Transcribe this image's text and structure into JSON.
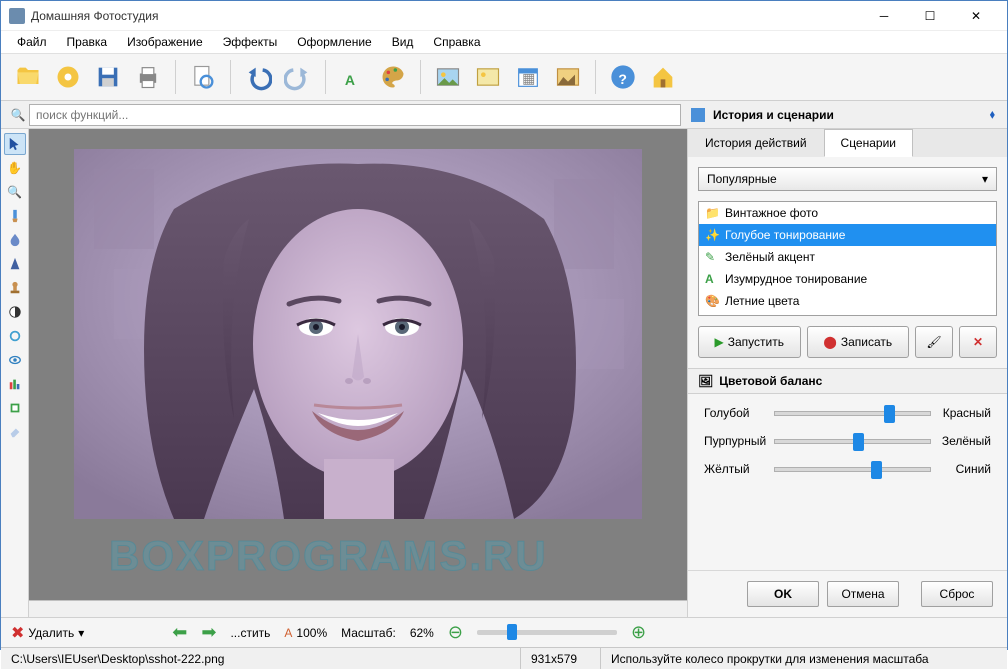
{
  "window": {
    "title": "Домашняя Фотостудия"
  },
  "menu": [
    "Файл",
    "Правка",
    "Изображение",
    "Эффекты",
    "Оформление",
    "Вид",
    "Справка"
  ],
  "toolbar_icons": [
    "open-folder-icon",
    "cd-icon",
    "save-icon",
    "print-icon",
    "preview-icon",
    "undo-icon",
    "redo-icon",
    "text-icon",
    "palette-icon",
    "image-1-icon",
    "image-2-icon",
    "calendar-icon",
    "templates-icon",
    "help-icon",
    "home-icon"
  ],
  "search": {
    "placeholder": "поиск функций..."
  },
  "left_tools": [
    "pointer-icon",
    "hand-icon",
    "zoom-icon",
    "brush-icon",
    "blur-drop-icon",
    "sharpen-icon",
    "stamp-icon",
    "contrast-icon",
    "circle-icon",
    "eye-icon",
    "levels-icon",
    "crop-icon",
    "eraser-icon"
  ],
  "right_panel": {
    "header": "История и сценарии",
    "tabs": [
      "История действий",
      "Сценарии"
    ],
    "active_tab": 1,
    "dropdown": "Популярные",
    "scenarios": [
      {
        "label": "Винтажное фото",
        "icon": "folder",
        "selected": false
      },
      {
        "label": "Голубое тонирование",
        "icon": "wand",
        "selected": true
      },
      {
        "label": "Зелёный акцент",
        "icon": "pencil",
        "selected": false
      },
      {
        "label": "Изумрудное тонирование",
        "icon": "letter",
        "selected": false
      },
      {
        "label": "Летние цвета",
        "icon": "palette",
        "selected": false
      }
    ],
    "actions": {
      "run": "Запустить",
      "record": "Записать"
    },
    "sub_header": "Цветовой баланс",
    "sliders": [
      {
        "left": "Голубой",
        "right": "Красный",
        "pos": 70
      },
      {
        "left": "Пурпурный",
        "right": "Зелёный",
        "pos": 50
      },
      {
        "left": "Жёлтый",
        "right": "Синий",
        "pos": 62
      }
    ],
    "buttons": {
      "ok": "OK",
      "cancel": "Отмена",
      "reset": "Сброс"
    }
  },
  "bottom": {
    "delete": "Удалить",
    "fit": "...стить",
    "scale_100_label": "100%",
    "scale_label": "Масштаб:",
    "scale_value": "62%"
  },
  "status": {
    "path": "C:\\Users\\IEUser\\Desktop\\sshot-222.png",
    "dims": "931x579",
    "hint": "Используйте колесо прокрутки для изменения масштаба"
  },
  "watermark": "BOXPROGRAMS.RU"
}
